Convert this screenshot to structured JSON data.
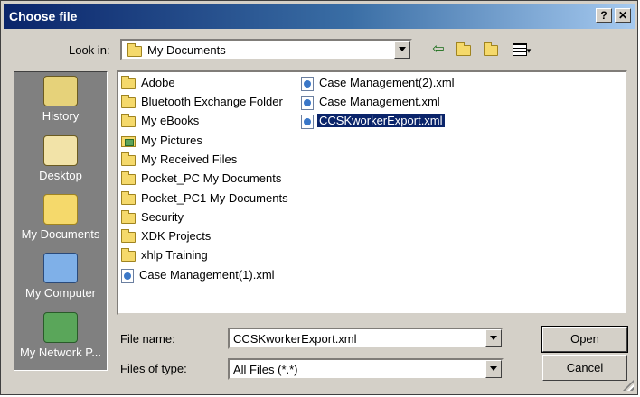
{
  "window": {
    "title": "Choose file",
    "help_btn": "?",
    "close_btn": "✕"
  },
  "lookin": {
    "label": "Look in:",
    "value": "My Documents"
  },
  "places": [
    {
      "label": "History",
      "icon": "history-icon"
    },
    {
      "label": "Desktop",
      "icon": "desktop-icon"
    },
    {
      "label": "My Documents",
      "icon": "my-documents-icon"
    },
    {
      "label": "My Computer",
      "icon": "my-computer-icon"
    },
    {
      "label": "My Network P...",
      "icon": "network-places-icon"
    }
  ],
  "files_col1": [
    {
      "name": "Adobe",
      "icon": "folder-icon"
    },
    {
      "name": "Bluetooth Exchange Folder",
      "icon": "folder-icon"
    },
    {
      "name": "My eBooks",
      "icon": "folder-icon"
    },
    {
      "name": "My Pictures",
      "icon": "pictures-folder-icon"
    },
    {
      "name": "My Received Files",
      "icon": "folder-icon"
    },
    {
      "name": "Pocket_PC My Documents",
      "icon": "folder-icon"
    },
    {
      "name": "Pocket_PC1 My Documents",
      "icon": "folder-icon"
    },
    {
      "name": "Security",
      "icon": "folder-icon"
    },
    {
      "name": "XDK Projects",
      "icon": "folder-icon"
    },
    {
      "name": "xhlp Training",
      "icon": "folder-icon"
    },
    {
      "name": "Case Management(1).xml",
      "icon": "xml-file-icon"
    }
  ],
  "files_col2": [
    {
      "name": "Case Management(2).xml",
      "icon": "xml-file-icon"
    },
    {
      "name": "Case Management.xml",
      "icon": "xml-file-icon"
    },
    {
      "name": "CCSKworkerExport.xml",
      "icon": "xml-file-icon",
      "selected": true
    }
  ],
  "filename": {
    "label": "File name:",
    "value": "CCSKworkerExport.xml"
  },
  "filetype": {
    "label": "Files of type:",
    "value": "All Files (*.*)"
  },
  "buttons": {
    "open": "Open",
    "cancel": "Cancel"
  },
  "colors": {
    "title_start": "#0a246a",
    "title_end": "#a6caf0",
    "selection": "#0a246a",
    "face": "#d4d0c8",
    "places_bg": "#808080"
  }
}
